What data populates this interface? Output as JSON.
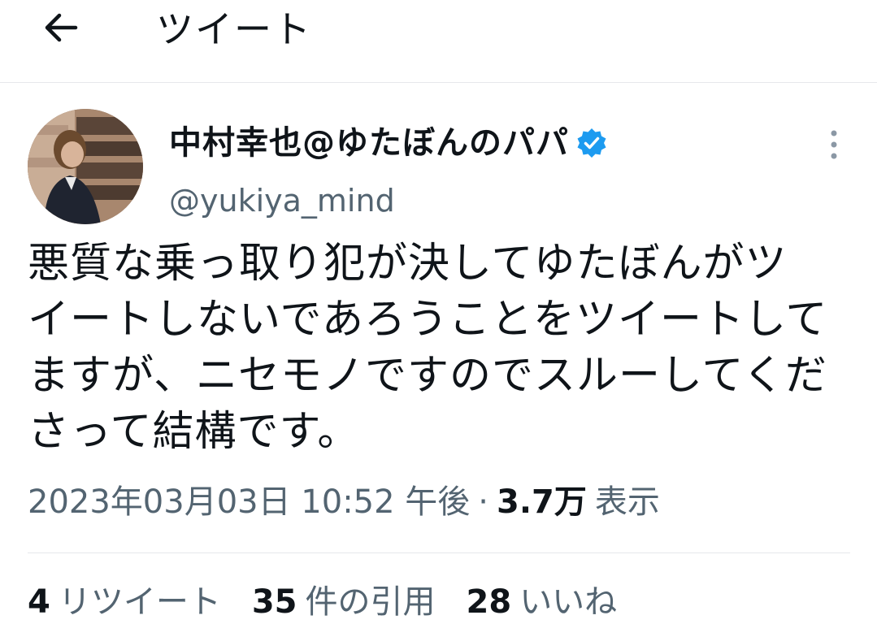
{
  "header": {
    "title": "ツイート",
    "back_icon": "arrow-left-icon"
  },
  "tweet": {
    "author": {
      "display_name": "中村幸也@ゆたぼんのパパ",
      "handle": "@yukiya_mind",
      "verified": true,
      "verified_color": "#1d9bf0"
    },
    "text": "悪質な乗っ取り犯が決してゆたぼんがツ\nイートしないであろうことをツイートして\nますが、ニセモノですのでスルーしてくだ\nさって結構です。",
    "timestamp": "2023年03月03日 10:52 午後",
    "separator": "·",
    "views_count": "3.7万",
    "views_label": "表示"
  },
  "stats": {
    "retweets": {
      "count": "4",
      "label": "リツイート"
    },
    "quotes": {
      "count": "35",
      "label": "件の引用"
    },
    "likes": {
      "count": "28",
      "label": "いいね"
    }
  },
  "colors": {
    "text_primary": "#0f1419",
    "text_secondary": "#536471",
    "divider": "#e6e8eb"
  }
}
